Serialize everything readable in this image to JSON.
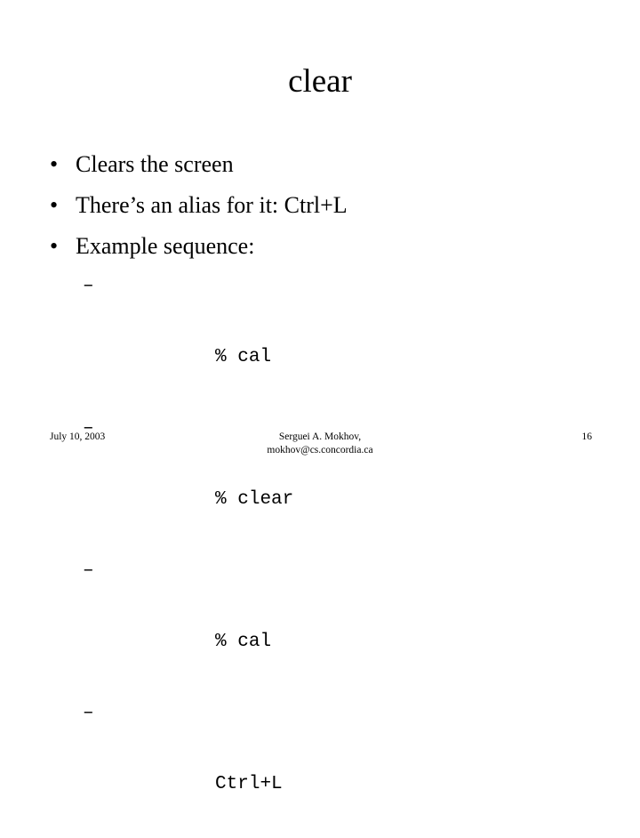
{
  "slide": {
    "title": "clear",
    "bullets": [
      {
        "marker": "•",
        "text": "Clears the screen"
      },
      {
        "marker": "•",
        "text": "There’s an alias for it: Ctrl+L"
      },
      {
        "marker": "•",
        "text": "Example sequence:"
      }
    ],
    "sub_bullets": [
      {
        "marker": "–",
        "text": "% cal"
      },
      {
        "marker": "–",
        "text": "% clear"
      },
      {
        "marker": "–",
        "text": "% cal"
      },
      {
        "marker": "–",
        "text": "Ctrl+L"
      }
    ]
  },
  "footer": {
    "date": "July 10, 2003",
    "author": "Serguei A. Mokhov,",
    "email": "mokhov@cs.concordia.ca",
    "page_number": "16"
  },
  "colors": {
    "background": "#ffffff",
    "text": "#000000"
  }
}
